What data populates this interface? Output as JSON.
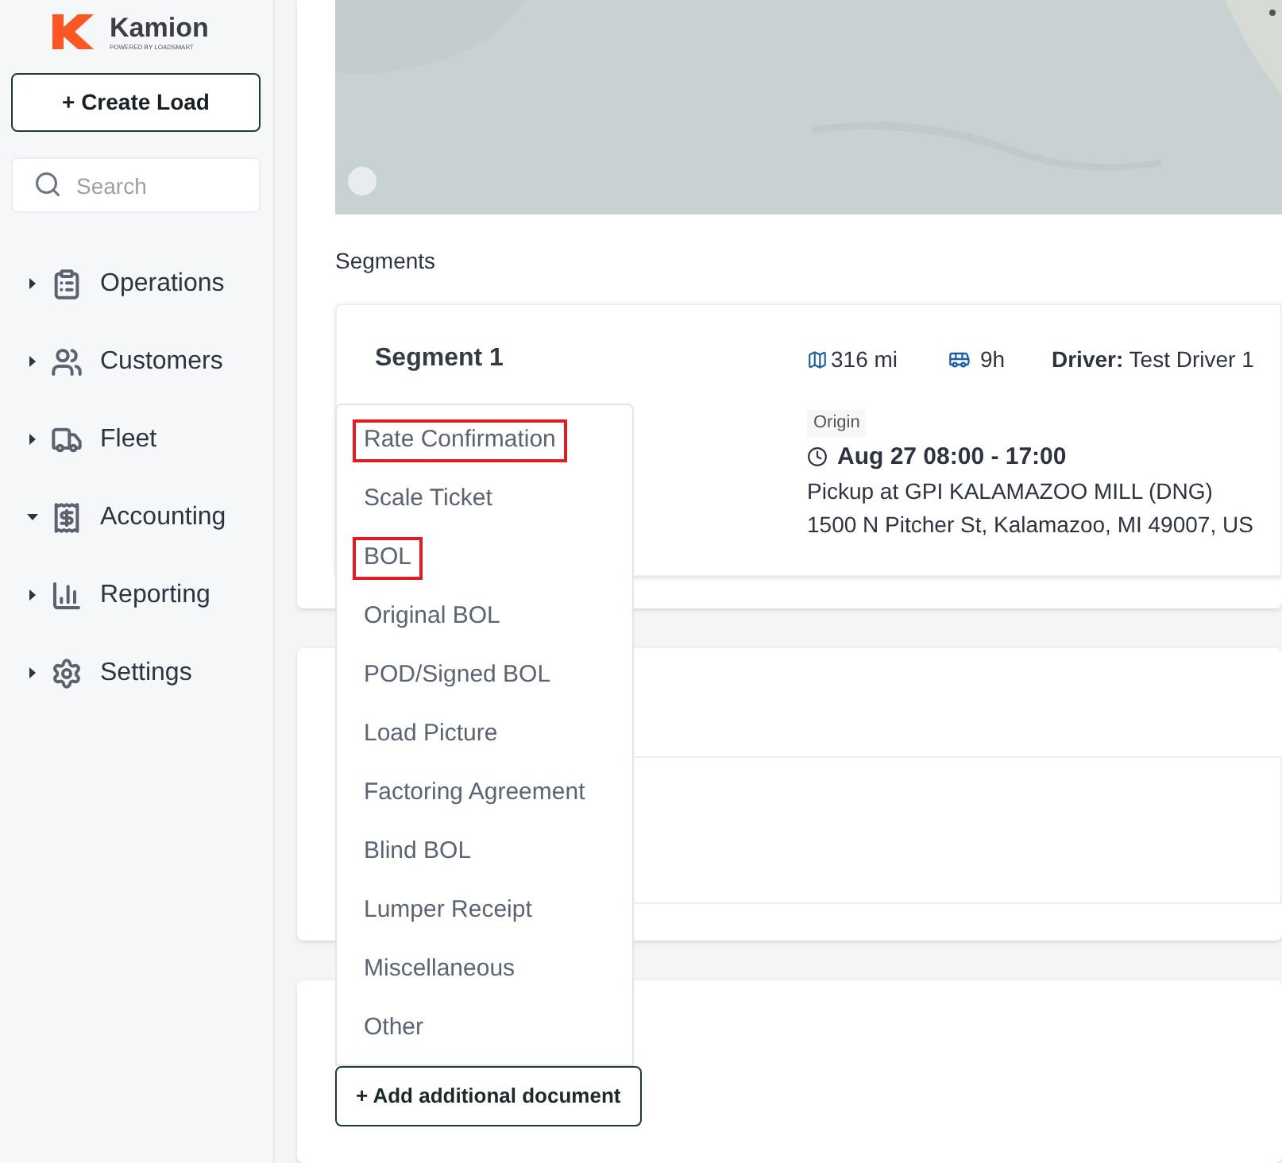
{
  "brand": {
    "name": "Kamion",
    "tagline": "POWERED BY LOADSMART"
  },
  "create_button": "+ Create Load",
  "search": {
    "placeholder": "Search"
  },
  "nav": [
    {
      "label": "Operations",
      "kind": "clipboard",
      "expanded": false
    },
    {
      "label": "Customers",
      "kind": "people",
      "expanded": false
    },
    {
      "label": "Fleet",
      "kind": "truck",
      "expanded": false
    },
    {
      "label": "Accounting",
      "kind": "ledger",
      "expanded": true
    },
    {
      "label": "Reporting",
      "kind": "chart",
      "expanded": false
    },
    {
      "label": "Settings",
      "kind": "gear",
      "expanded": false
    }
  ],
  "segments_heading": "Segments",
  "segment": {
    "title": "Segment 1",
    "distance": "316 mi",
    "duration": "9h",
    "driver_label": "Driver:",
    "driver": "Test Driver 1",
    "stop_tag": "Origin",
    "window": "Aug 27 08:00 - 17:00",
    "facility": "Pickup at GPI KALAMAZOO MILL (DNG)",
    "address": "1500 N Pitcher St, Kalamazoo, MI 49007, US"
  },
  "document_menu": [
    {
      "label": "Rate Confirmation",
      "highlighted": true
    },
    {
      "label": "Scale Ticket",
      "highlighted": false
    },
    {
      "label": "BOL",
      "highlighted": true
    },
    {
      "label": "Original BOL",
      "highlighted": false
    },
    {
      "label": "POD/Signed BOL",
      "highlighted": false
    },
    {
      "label": "Load Picture",
      "highlighted": false
    },
    {
      "label": "Factoring Agreement",
      "highlighted": false
    },
    {
      "label": "Blind BOL",
      "highlighted": false
    },
    {
      "label": "Lumper Receipt",
      "highlighted": false
    },
    {
      "label": "Miscellaneous",
      "highlighted": false
    },
    {
      "label": "Other",
      "highlighted": false
    }
  ],
  "add_document_button": "+ Add additional document"
}
